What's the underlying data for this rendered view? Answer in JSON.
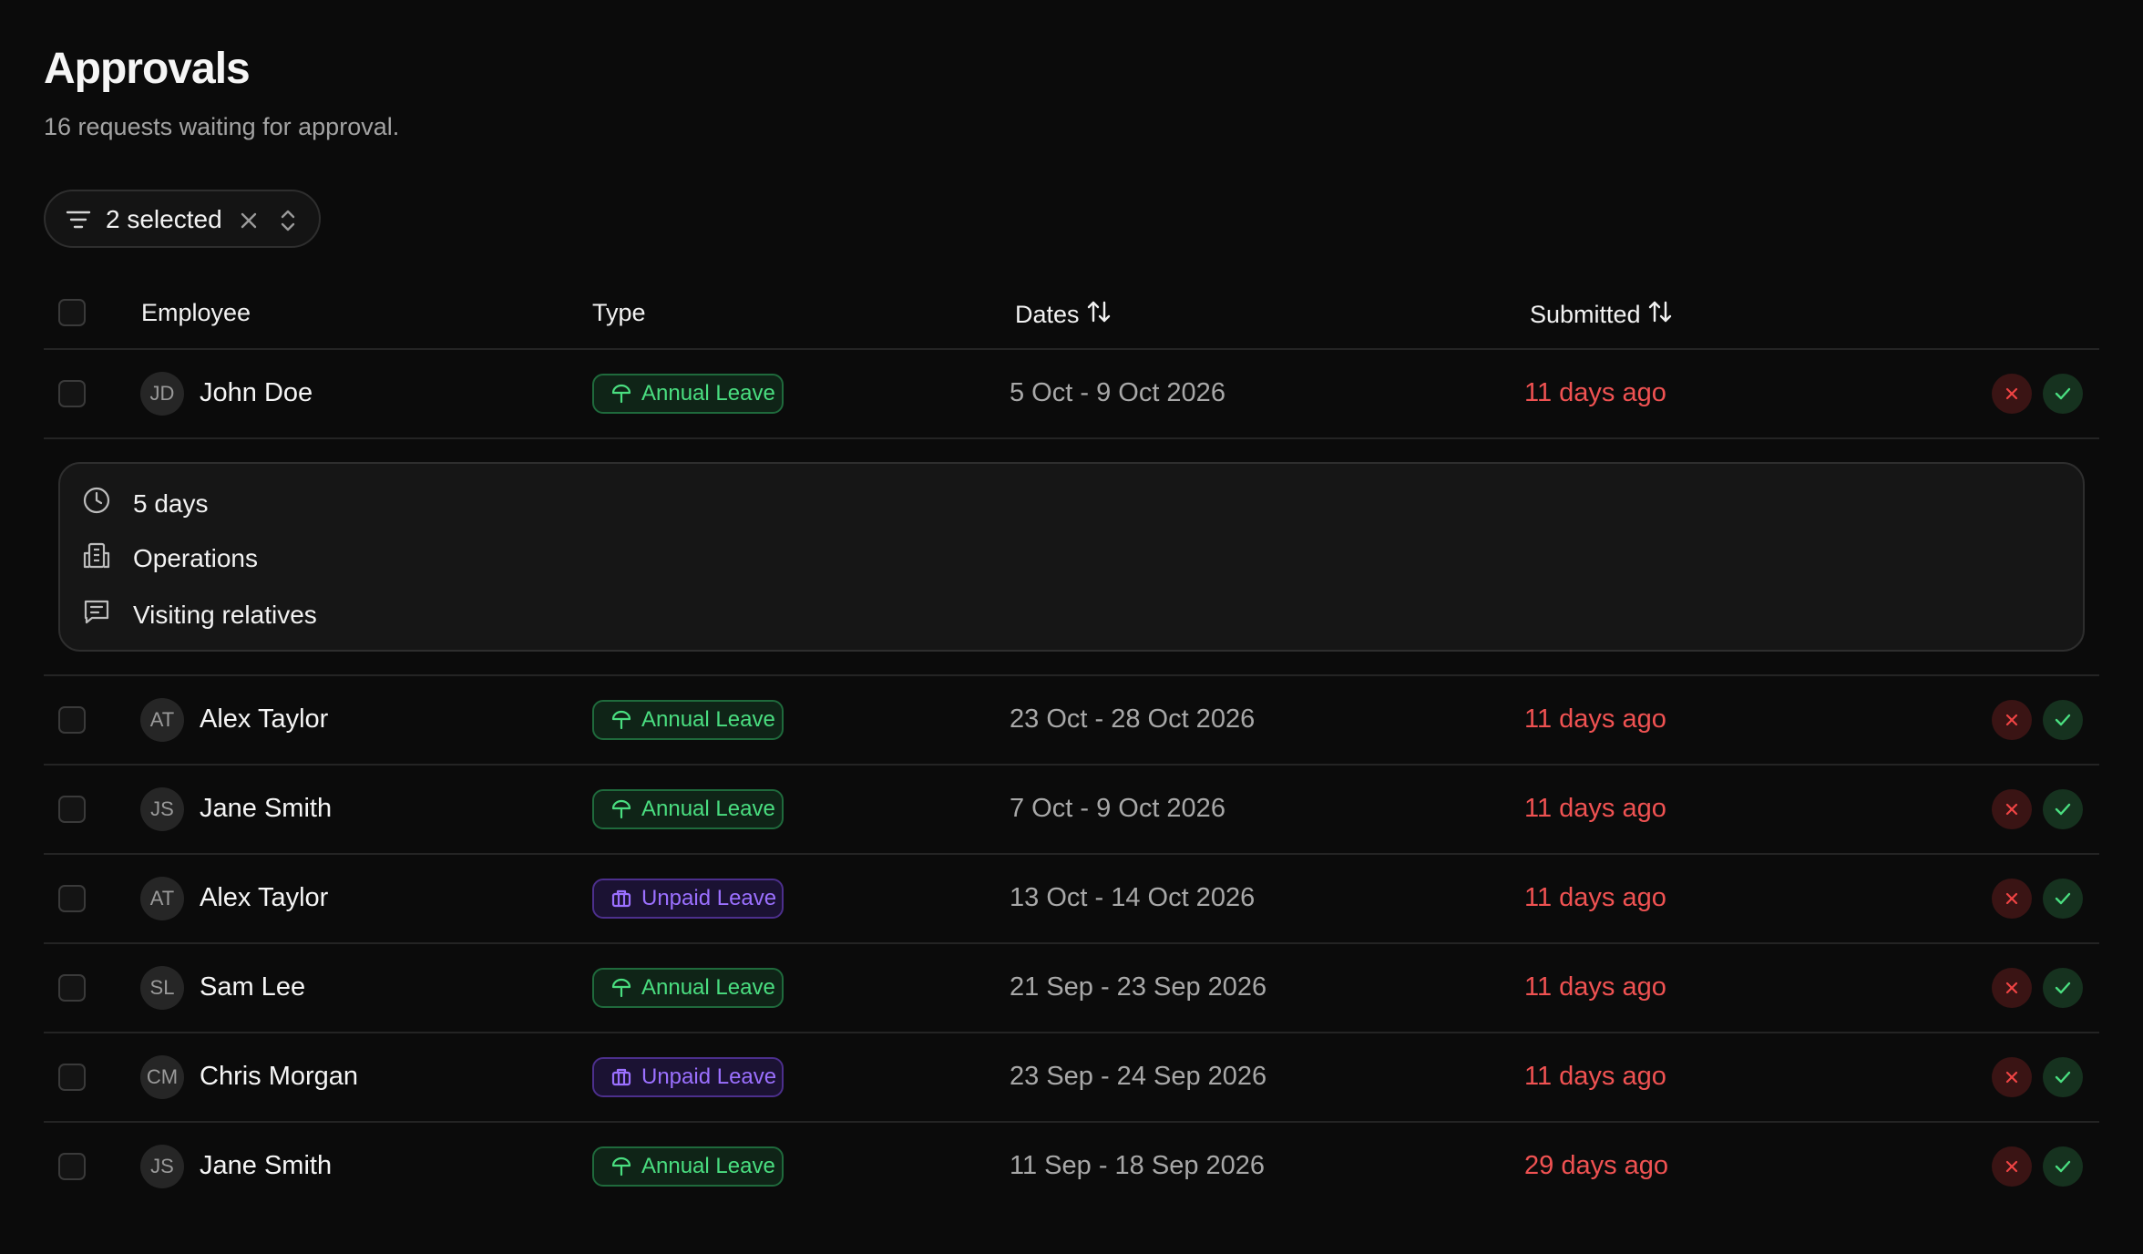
{
  "page": {
    "title": "Approvals",
    "subtitle": "16 requests waiting for approval."
  },
  "filter": {
    "label": "2 selected",
    "icon": "filter-icon",
    "clear_icon": "close-icon",
    "sort_icon": "chevron-up-down-icon"
  },
  "table": {
    "headers": {
      "employee": "Employee",
      "type": "Type",
      "dates": "Dates",
      "submitted": "Submitted"
    },
    "expanded": {
      "duration": "5 days",
      "department": "Operations",
      "reason": "Visiting relatives"
    },
    "rows": [
      {
        "initials": "JD",
        "name": "John Doe",
        "type": "Annual Leave",
        "kind": "annual",
        "dates": "5 Oct - 9 Oct 2026",
        "submitted": "11 days ago"
      },
      {
        "initials": "AT",
        "name": "Alex Taylor",
        "type": "Annual Leave",
        "kind": "annual",
        "dates": "23 Oct - 28 Oct 2026",
        "submitted": "11 days ago"
      },
      {
        "initials": "JS",
        "name": "Jane Smith",
        "type": "Annual Leave",
        "kind": "annual",
        "dates": "7 Oct - 9 Oct 2026",
        "submitted": "11 days ago"
      },
      {
        "initials": "AT",
        "name": "Alex Taylor",
        "type": "Unpaid Leave",
        "kind": "unpaid",
        "dates": "13 Oct - 14 Oct 2026",
        "submitted": "11 days ago"
      },
      {
        "initials": "SL",
        "name": "Sam Lee",
        "type": "Annual Leave",
        "kind": "annual",
        "dates": "21 Sep - 23 Sep 2026",
        "submitted": "11 days ago"
      },
      {
        "initials": "CM",
        "name": "Chris Morgan",
        "type": "Unpaid Leave",
        "kind": "unpaid",
        "dates": "23 Sep - 24 Sep 2026",
        "submitted": "11 days ago"
      },
      {
        "initials": "JS",
        "name": "Jane Smith",
        "type": "Annual Leave",
        "kind": "annual",
        "dates": "11 Sep - 18 Sep 2026",
        "submitted": "29 days ago"
      }
    ]
  },
  "colors": {
    "background": "#0b0b0b",
    "annual": "#4ade80",
    "unpaid": "#9b70ff",
    "submitted": "#f05252"
  }
}
